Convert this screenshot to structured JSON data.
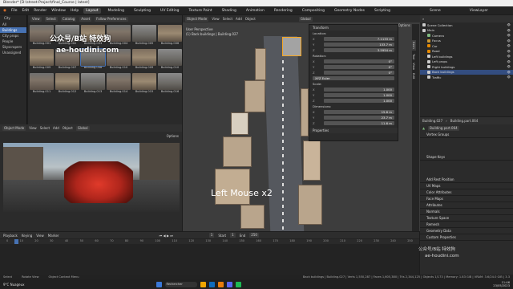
{
  "window": {
    "title": "Blender* [D:\\street-Project\\final_Course | latest]"
  },
  "menu": {
    "items": [
      "File",
      "Edit",
      "Render",
      "Window",
      "Help"
    ],
    "tabs": [
      "Layout",
      "Modeling",
      "Sculpting",
      "UV Editing",
      "Texture Paint",
      "Shading",
      "Animation",
      "Rendering",
      "Compositing",
      "Geometry Nodes",
      "Scripting"
    ],
    "active_tab": "Layout",
    "scene": "Scene",
    "view_layer": "ViewLayer"
  },
  "asset_browser": {
    "library": "City",
    "header": [
      "View",
      "Select",
      "Catalog",
      "Asset"
    ],
    "preferences": "Follow Preferences",
    "categories": [
      "All",
      "Buildings",
      "City props",
      "People",
      "Skyscrapers",
      "Unassigned"
    ],
    "selected_category": "Buildings",
    "assets": [
      "Building.001",
      "Building.002",
      "Building.003",
      "Building.004",
      "Building.005",
      "Building.006",
      "Building.009",
      "Building.007",
      "Building.008",
      "Building.010",
      "Building.009",
      "Building.010",
      "Building.011",
      "Building.012",
      "Building.013",
      "Building.014",
      "Building.015",
      "Building.016"
    ],
    "selected_asset": "Building.008"
  },
  "viewport_left": {
    "mode": "Object Mode",
    "header": [
      "View",
      "Select",
      "Add",
      "Object"
    ],
    "orientation": "Global",
    "options": "Options"
  },
  "viewport_main": {
    "mode": "Object Mode",
    "header": [
      "View",
      "Select",
      "Add",
      "Object"
    ],
    "orientation": "Global",
    "perspective": "User Perspective",
    "context": "(1) Back buildings | Building.027",
    "options": "Options",
    "overlay_text": "Left Mouse x2",
    "side_tabs": [
      "Item",
      "Tool",
      "View",
      "Edit"
    ]
  },
  "transform": {
    "title": "Transform",
    "location_label": "Location:",
    "location": [
      {
        "k": "X",
        "v": "7.1133 m"
      },
      {
        "k": "Y",
        "v": "133.7 m"
      },
      {
        "k": "Z",
        "v": "3.5954 m"
      }
    ],
    "rotation_label": "Rotation:",
    "rotation": [
      {
        "k": "X",
        "v": "0°"
      },
      {
        "k": "Y",
        "v": "0°"
      },
      {
        "k": "Z",
        "v": "0°"
      }
    ],
    "rotation_mode": "XYZ Euler",
    "scale_label": "Scale:",
    "scale": [
      {
        "k": "X",
        "v": "1.000"
      },
      {
        "k": "Y",
        "v": "1.000"
      },
      {
        "k": "Z",
        "v": "1.000"
      }
    ],
    "dimensions_label": "Dimensions:",
    "dimensions": [
      {
        "k": "X",
        "v": "15.8 m"
      },
      {
        "k": "Y",
        "v": "23.7 m"
      },
      {
        "k": "Z",
        "v": "11.6 m"
      }
    ],
    "properties": "Properties"
  },
  "outliner": {
    "title": "Scene Collection",
    "rows": [
      {
        "label": "Scene Collection",
        "color": "#cccccc",
        "sel": false
      },
      {
        "label": "Main",
        "color": "#cccccc",
        "sel": false
      },
      {
        "label": "Camera",
        "color": "#7fb77e",
        "sel": false
      },
      {
        "label": "Focus",
        "color": "#cc9933",
        "sel": false
      },
      {
        "label": "Car",
        "color": "#e68a00",
        "sel": false
      },
      {
        "label": "Road",
        "color": "#e68a00",
        "sel": false
      },
      {
        "label": "Left buildings",
        "color": "#cccccc",
        "sel": false
      },
      {
        "label": "Left props",
        "color": "#cccccc",
        "sel": false
      },
      {
        "label": "Right buildings",
        "color": "#cccccc",
        "sel": false
      },
      {
        "label": "Back buildings",
        "color": "#cccccc",
        "sel": true
      },
      {
        "label": "Traffic",
        "color": "#cccccc",
        "sel": false
      }
    ]
  },
  "properties": {
    "breadcrumb": [
      "Building.027",
      "Building.part.064"
    ],
    "data_name": "Building.part.064",
    "sections": [
      "Vertex Groups",
      "Shape Keys",
      "Add Rest Position",
      "UV Maps",
      "Color Attributes",
      "Face Maps",
      "Attributes",
      "Normals",
      "Texture Space",
      "Remesh",
      "Geometry Data",
      "Custom Properties"
    ]
  },
  "timeline": {
    "header": [
      "Playback",
      "Keying",
      "View",
      "Marker"
    ],
    "current_frame": "1",
    "start_label": "Start",
    "start": "1",
    "end_label": "End",
    "end": "250",
    "ticks": [
      "0",
      "10",
      "20",
      "30",
      "40",
      "50",
      "60",
      "70",
      "80",
      "90",
      "100",
      "110",
      "120",
      "130",
      "140",
      "150",
      "160",
      "170",
      "180",
      "190",
      "200",
      "210",
      "220",
      "230",
      "240",
      "250"
    ]
  },
  "statusbar": {
    "items": [
      "Select",
      "Rotate View",
      "Object Context Menu"
    ],
    "stats": "Back buildings | Building.027 | Verts 1,550,287 | Faces 1,605,380 | Tris 2,344,125 | Objects 1/173 | Memory: 1.83 GiB | VRAM: 3.6/24.0 GiB | 3.3"
  },
  "taskbar": {
    "search": "Rechercher",
    "weather": "9°C Nuageux",
    "time": "11:46",
    "date": "23/05/2023"
  },
  "watermark": {
    "line1": "公众号/B站 特效狗",
    "line2": "ae-houdini.com",
    "line3": "公众号/B站 特效狗",
    "line4": "ae-houdini.com"
  }
}
